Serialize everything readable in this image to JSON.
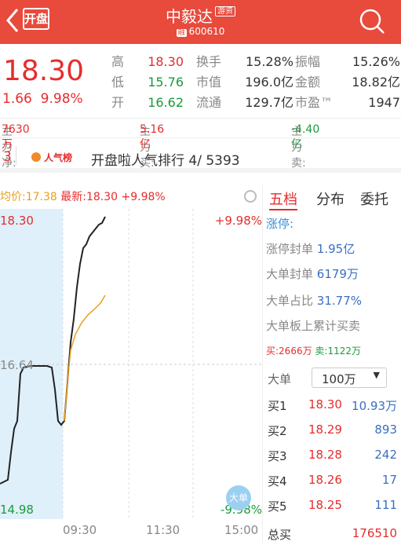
{
  "header": {
    "logo": "开盘",
    "name": "中毅达",
    "name_tag": "游资",
    "code_tag": "融",
    "code": "600610"
  },
  "quote": {
    "price": "18.30",
    "change": "1.66",
    "change_pct": "9.98%",
    "rows": [
      [
        {
          "l": "高",
          "v": "18.30",
          "c": "red"
        },
        {
          "l": "换手",
          "v": "15.28%",
          "c": "normal"
        },
        {
          "l": "振幅",
          "v": "15.26%",
          "c": "normal"
        }
      ],
      [
        {
          "l": "低",
          "v": "15.76",
          "c": "grn"
        },
        {
          "l": "市值",
          "v": "196.0亿",
          "c": "normal"
        },
        {
          "l": "金额",
          "v": "18.82亿",
          "c": "normal"
        }
      ],
      [
        {
          "l": "开",
          "v": "16.62",
          "c": "grn"
        },
        {
          "l": "流通",
          "v": "129.7亿",
          "c": "normal"
        },
        {
          "l": "市盈™",
          "v": "1947",
          "c": "normal"
        }
      ]
    ]
  },
  "flow": {
    "net_label": "主力净:",
    "net_value": "7630万",
    "buy_label": "主力买:",
    "buy_value": "5.16亿",
    "sell_label": "主力卖:",
    "sell_value": "-4.40亿"
  },
  "rank": {
    "num": "3",
    "badge": "人气榜",
    "text": "开盘啦人气排行 4/ 5393"
  },
  "chart": {
    "avg_label": "均价:17.38",
    "latest_label": "最新:18.30",
    "latest_pct": "+9.98%",
    "price_top": "18.30",
    "price_mid": "16.64",
    "price_bottom": "14.98",
    "pct_top": "+9.98%",
    "pct_bottom": "-9.98%",
    "times": [
      "09:30",
      "11:30",
      "15:00"
    ],
    "big_order_badge": "大单"
  },
  "panel": {
    "tabs": [
      "五档",
      "分布",
      "委托"
    ],
    "limit_up": "涨停:",
    "seal_label": "涨停封单",
    "seal_value": "1.95亿",
    "big_seal_label": "大单封单",
    "big_seal_value": "6179万",
    "big_ratio_label": "大单占比",
    "big_ratio_value": "31.77%",
    "accum_label": "大单板上累计买卖",
    "buy_label": "买:",
    "buy_value": "2666万",
    "sell_label": "卖:",
    "sell_value": "1122万",
    "big_label": "大单",
    "select_value": "100万",
    "orders": [
      {
        "label": "买1",
        "price": "18.30",
        "vol": "10.93万"
      },
      {
        "label": "买2",
        "price": "18.29",
        "vol": "893"
      },
      {
        "label": "买3",
        "price": "18.28",
        "vol": "242"
      },
      {
        "label": "买4",
        "price": "18.26",
        "vol": "17"
      },
      {
        "label": "买5",
        "price": "18.25",
        "vol": "111"
      }
    ],
    "total_label": "总买",
    "total_value": "176510"
  }
}
